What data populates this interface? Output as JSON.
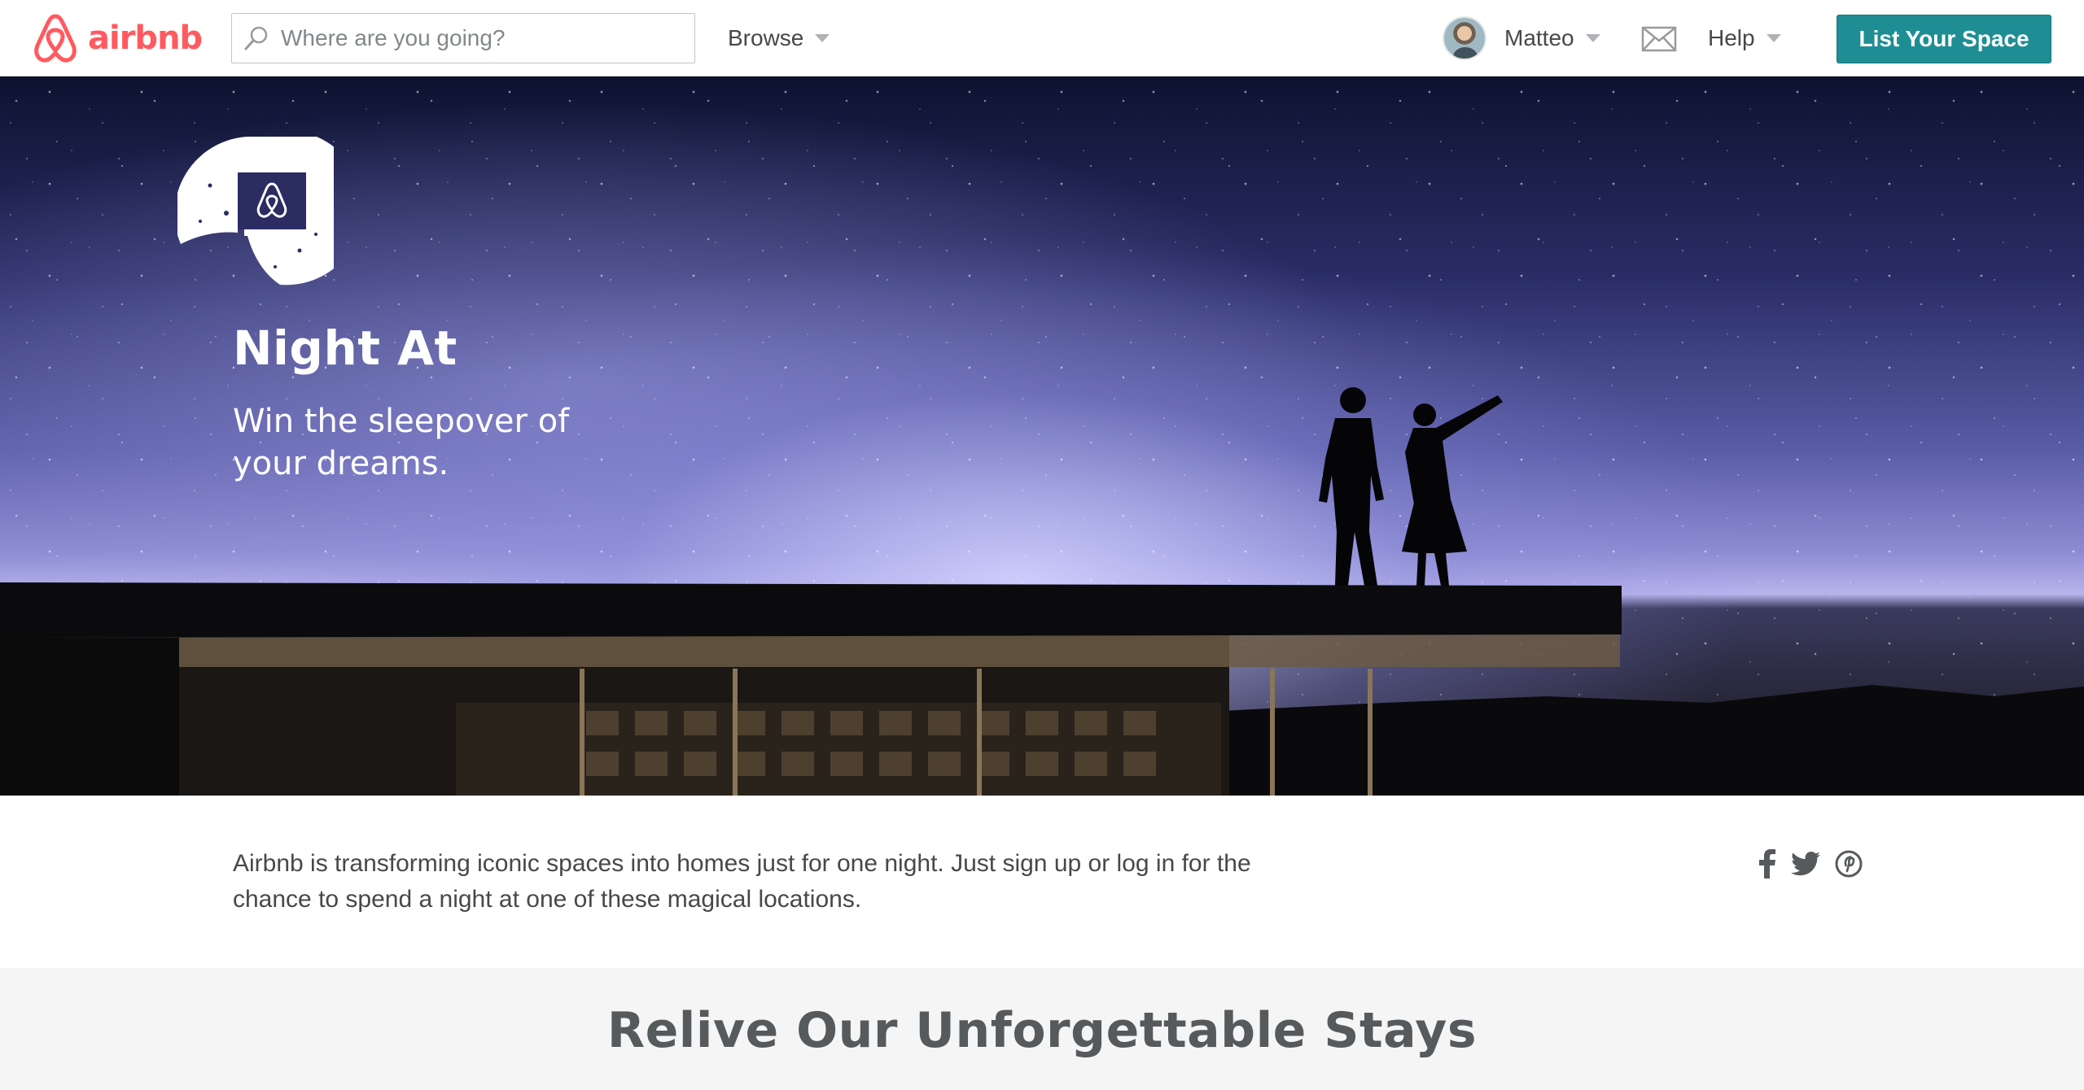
{
  "header": {
    "logo_text": "airbnb",
    "search_placeholder": "Where are you going?",
    "search_value": "",
    "browse_label": "Browse",
    "user_name": "Matteo",
    "help_label": "Help",
    "list_space_label": "List Your Space",
    "icons": [
      "airbnb-logo-icon",
      "search-icon",
      "chevron-down-icon",
      "avatar",
      "mail-icon"
    ]
  },
  "hero": {
    "title": "Night At",
    "subtitle": "Win the sleepover of your dreams.",
    "badge_icon": "airbnb-belo-icon"
  },
  "intro": {
    "text": "Airbnb is transforming iconic spaces into homes just for one night. Just sign up or log in for the chance to spend a night at one of these magical locations."
  },
  "social": {
    "icons": [
      "facebook-icon",
      "twitter-icon",
      "pinterest-icon"
    ]
  },
  "section": {
    "heading": "Relive Our Unforgettable Stays"
  },
  "colors": {
    "brand": "#ff5a5f",
    "accent_button": "#1f8d94",
    "text": "#484848",
    "band_bg": "#f5f5f5"
  }
}
